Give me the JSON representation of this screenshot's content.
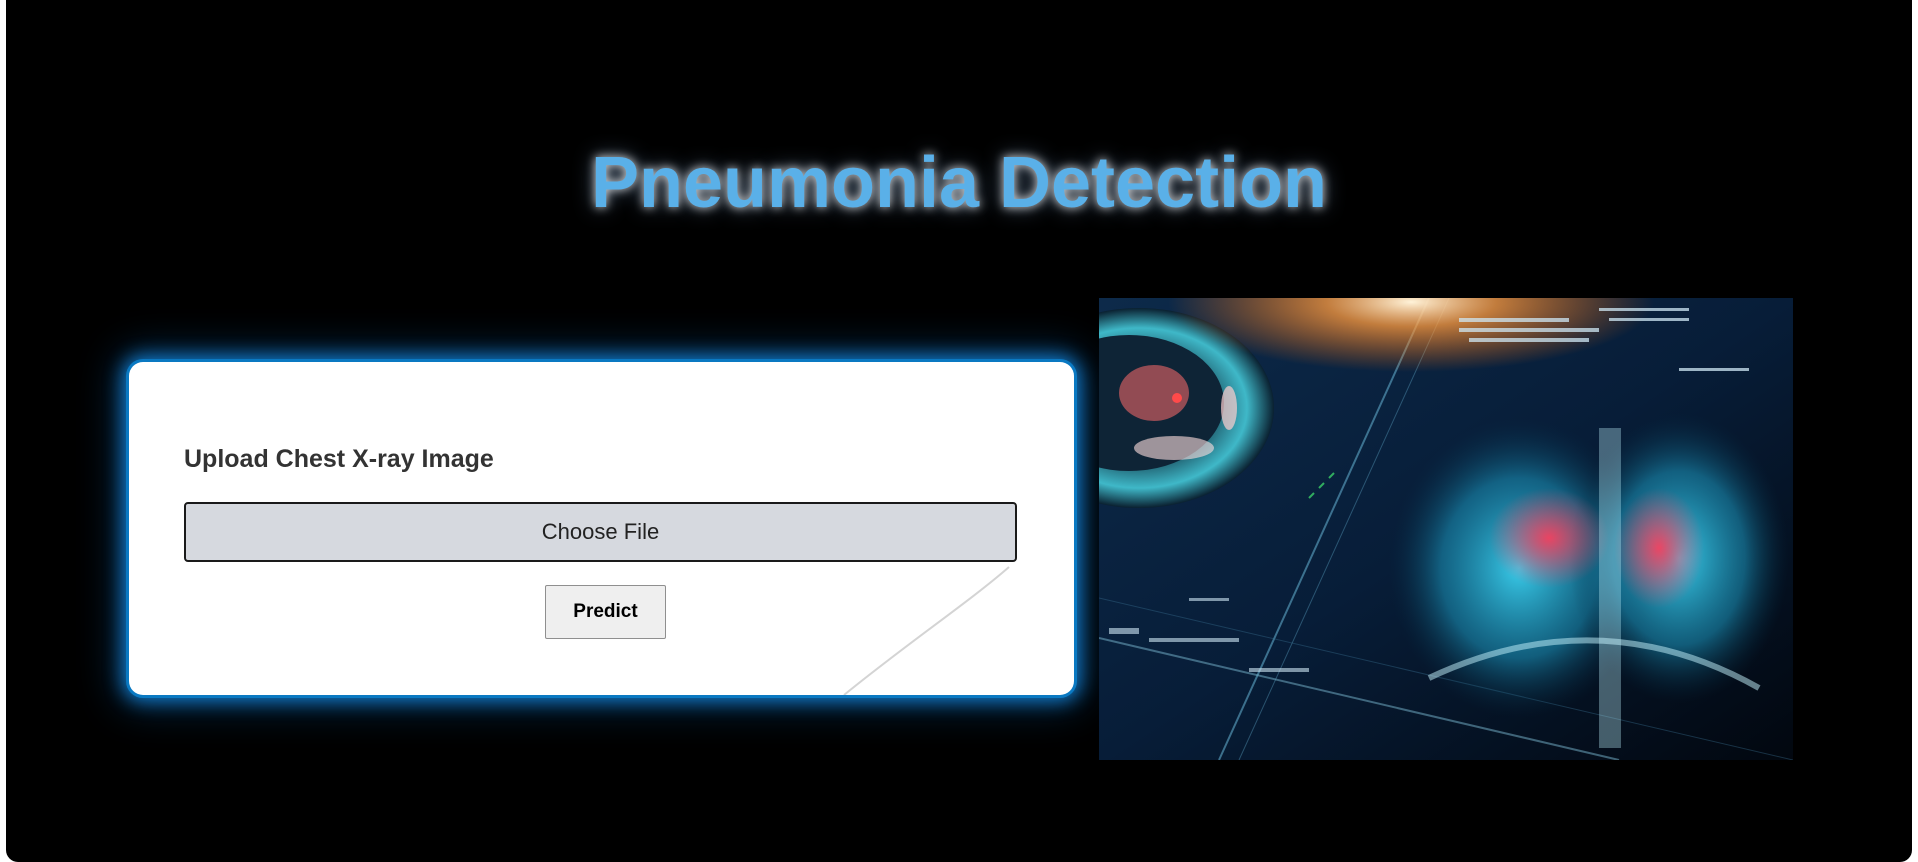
{
  "page": {
    "title": "Pneumonia Detection"
  },
  "upload_form": {
    "label": "Upload Chest X-ray Image",
    "file_input_label": "Choose File",
    "predict_label": "Predict"
  },
  "colors": {
    "background": "#000000",
    "title": "#5ab0e8",
    "card_glow": "#0a79c2",
    "card": "#ffffff",
    "file_input_bg": "#d6d9df",
    "button_bg": "#efefef"
  },
  "icons": {
    "hero_image": "chest-xray-monitor-image"
  }
}
